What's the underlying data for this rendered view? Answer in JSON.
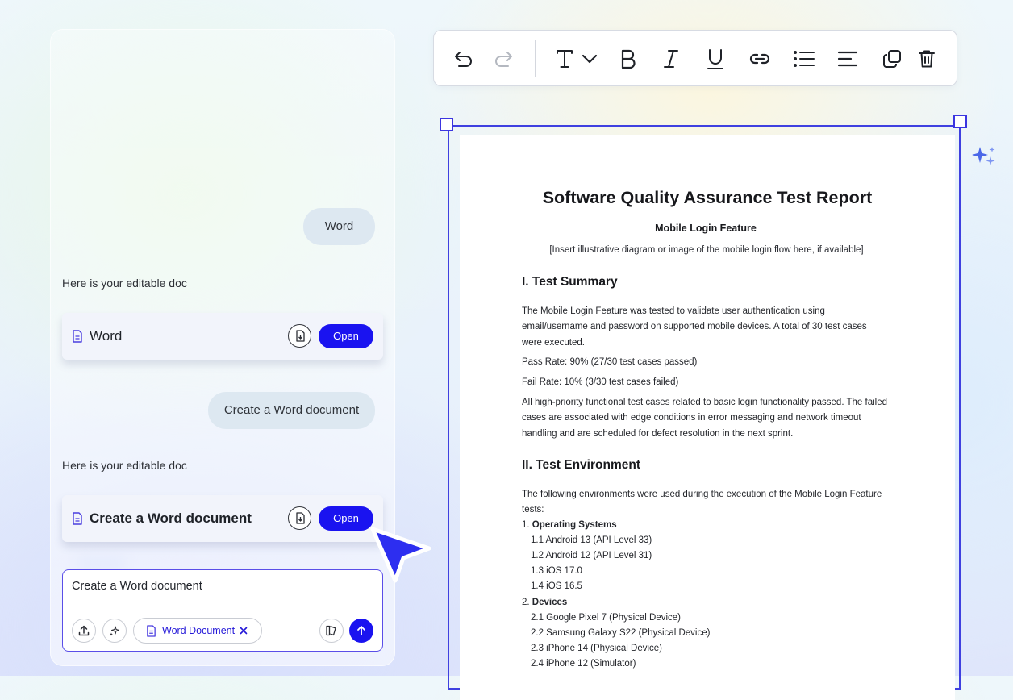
{
  "chat": {
    "messages": [
      {
        "role": "user",
        "text": "Word"
      },
      {
        "role": "assistant",
        "text": "Here is your editable doc"
      },
      {
        "role": "user",
        "text": "Create a Word document"
      },
      {
        "role": "assistant",
        "text": "Here is your editable doc"
      }
    ],
    "cards": [
      {
        "title": "Word",
        "open_label": "Open",
        "icon": "document-icon"
      },
      {
        "title": "Create a Word document",
        "open_label": "Open",
        "icon": "document-icon"
      }
    ],
    "composer": {
      "value": "Create a Word document",
      "chip_label": "Word Document",
      "chip_icon": "document-icon"
    }
  },
  "toolbar": {
    "icons": [
      "undo-icon",
      "redo-icon",
      "text-style-icon",
      "chevron-down-icon",
      "bold-icon",
      "italic-icon",
      "underline-icon",
      "link-icon",
      "bullet-list-icon",
      "align-left-icon",
      "duplicate-icon",
      "delete-icon"
    ]
  },
  "document": {
    "title": "Software Quality Assurance Test Report",
    "subtitle": "Mobile Login Feature",
    "placeholder": "[Insert illustrative diagram or image of the mobile login flow here, if available]",
    "section1": {
      "heading": "I. Test Summary",
      "para1": "The Mobile Login Feature was tested to validate user authentication using email/username and password on supported mobile devices. A total of 30 test cases were executed.",
      "pass_rate": "Pass Rate: 90% (27/30 test cases passed)",
      "fail_rate": "Fail Rate: 10% (3/30 test cases failed)",
      "para2": "All high-priority functional test cases related to basic login functionality passed. The failed cases are associated with edge conditions in error messaging and network timeout handling and are scheduled for defect resolution in the next sprint."
    },
    "section2": {
      "heading": "II. Test Environment",
      "intro": "The following environments were used during the execution of the Mobile Login Feature tests:",
      "groups": [
        {
          "num": "1.",
          "label": "Operating Systems",
          "items": [
            "1.1 Android 13 (API Level 33)",
            "1.2 Android 12 (API Level 31)",
            "1.3 iOS 17.0",
            "1.4 iOS 16.5"
          ]
        },
        {
          "num": "2.",
          "label": "Devices",
          "items": [
            "2.1 Google Pixel 7 (Physical Device)",
            "2.2 Samsung Galaxy S22 (Physical Device)",
            "2.3 iPhone 14 (Physical Device)",
            "2.4 iPhone 12 (Simulator)"
          ]
        }
      ]
    }
  },
  "colors": {
    "accent": "#1a13f0",
    "selection": "#3f40e0",
    "bubble": "#dde8f1",
    "card": "#f2f4fb"
  }
}
